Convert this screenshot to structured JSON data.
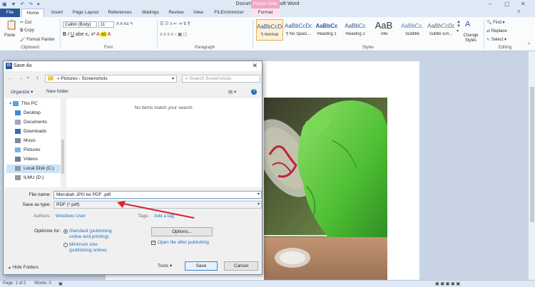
{
  "window": {
    "title": "Document1 - Microsoft Word",
    "context_tab": "Picture Tools"
  },
  "tabs": [
    "File",
    "Home",
    "Insert",
    "Page Layout",
    "References",
    "Mailings",
    "Review",
    "View",
    "FILEminimizer",
    "Format"
  ],
  "ribbon": {
    "clipboard": {
      "paste": "Paste",
      "cut": "Cut",
      "copy": "Copy",
      "format_painter": "Format Painter",
      "label": "Clipboard"
    },
    "font": {
      "name": "Calibri (Body)",
      "size": "11",
      "label": "Font"
    },
    "paragraph": {
      "label": "Paragraph"
    },
    "styles": {
      "label": "Styles",
      "items": [
        {
          "sample": "AaBbCcDc",
          "name": "¶ Normal"
        },
        {
          "sample": "AaBbCcDc",
          "name": "¶ No Spaci..."
        },
        {
          "sample": "AaBbCc",
          "name": "Heading 1"
        },
        {
          "sample": "AaBbCc",
          "name": "Heading 2"
        },
        {
          "sample": "AaB",
          "name": "Title"
        },
        {
          "sample": "AaBbCc.",
          "name": "Subtitle"
        },
        {
          "sample": "AaBbCcDc",
          "name": "Subtle Em..."
        }
      ],
      "change_styles": "Change Styles"
    },
    "editing": {
      "find": "Find",
      "replace": "Replace",
      "select": "Select",
      "label": "Editing"
    }
  },
  "dialog": {
    "title": "Save As",
    "breadcrumb": [
      "«",
      "Pictures",
      "›",
      "Screenshots"
    ],
    "search_placeholder": "Search Screenshots",
    "organize": "Organize",
    "new_folder": "New folder",
    "empty_message": "No items match your search.",
    "nav_items": [
      "This PC",
      "Desktop",
      "Documents",
      "Downloads",
      "Music",
      "Pictures",
      "Videos",
      "Local Disk (C:)",
      "ILMU (D:)"
    ],
    "file_name_label": "File name:",
    "file_name_value": "Merubah JPG ke PDF .pdf",
    "save_type_label": "Save as type:",
    "save_type_value": "PDF (*.pdf)",
    "authors_label": "Authors:",
    "authors_value": "Windows User",
    "tags_label": "Tags:",
    "tags_value": "Add a tag",
    "optimize_label": "Optimize for:",
    "opt_standard": "Standard (publishing online and printing)",
    "opt_standard_l1": "Standard (publishing",
    "opt_standard_l2": "online and printing)",
    "opt_minimum_l1": "Minimum size",
    "opt_minimum_l2": "(publishing online)",
    "options_button": "Options...",
    "open_after": "Open file after publishing",
    "hide_folders": "Hide Folders",
    "tools": "Tools",
    "save": "Save",
    "cancel": "Cancel"
  },
  "status": {
    "page": "Page: 1 of 2",
    "words": "Words: 0"
  },
  "colors": {
    "word_blue": "#2b579a",
    "format_pink": "#f3a5c8",
    "arrow_red": "#d9232b",
    "glove_green": "#5fc83a"
  }
}
